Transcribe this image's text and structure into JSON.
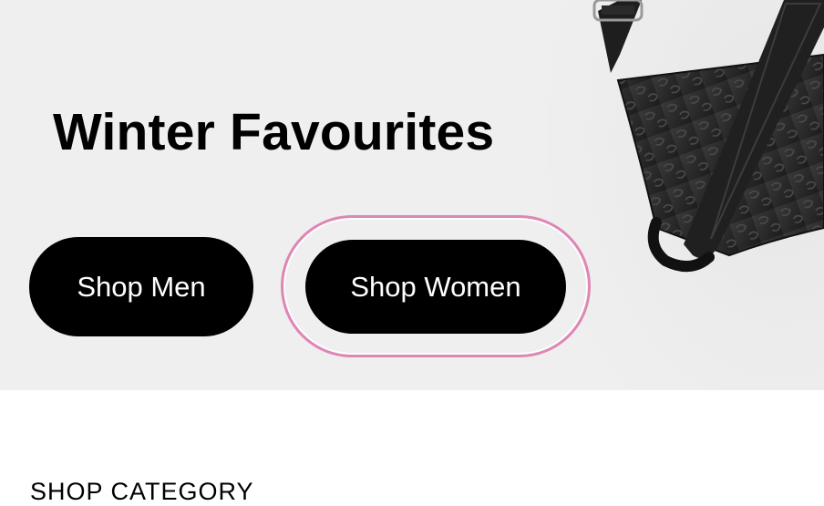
{
  "hero": {
    "title": "Winter Favourites",
    "buttons": {
      "men": "Shop Men",
      "women": "Shop Women"
    },
    "focus_ring_color": "#de86b4",
    "background_color": "#efefef"
  },
  "category_section": {
    "title": "SHOP CATEGORY"
  }
}
